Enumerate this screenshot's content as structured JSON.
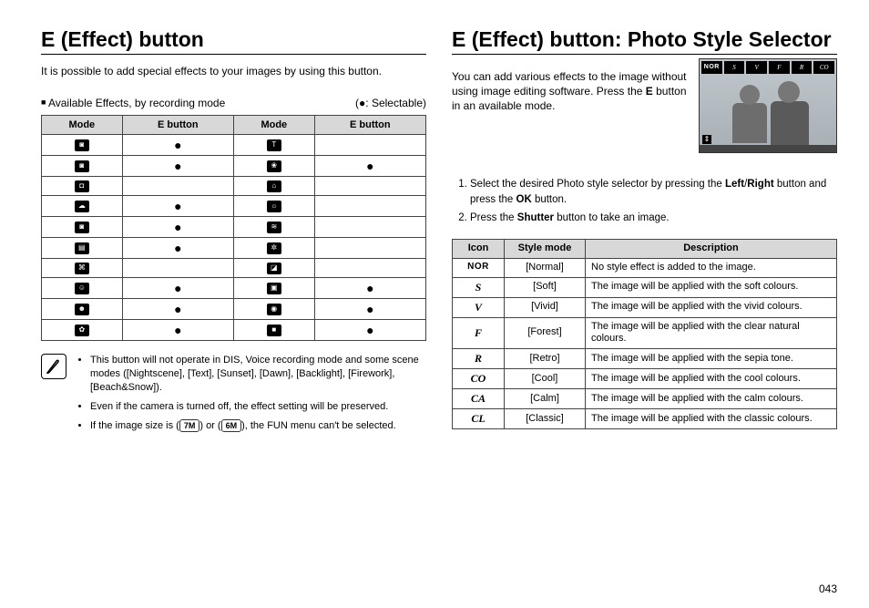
{
  "page_number": "043",
  "left": {
    "heading": "E (Effect) button",
    "intro": "It is possible to add special effects to your images by using this button.",
    "subhead": "Available Effects, by recording mode",
    "legend": "(●: Selectable)",
    "table": {
      "headers": [
        "Mode",
        "E button",
        "Mode",
        "E button"
      ],
      "rows": [
        {
          "m1": "◙",
          "e1": "●",
          "m2": "T",
          "e2": ""
        },
        {
          "m1": "◙",
          "e1": "●",
          "m2": "❀",
          "e2": "●"
        },
        {
          "m1": "◘",
          "e1": "",
          "m2": "⌂",
          "e2": ""
        },
        {
          "m1": "☁",
          "e1": "●",
          "m2": "☼",
          "e2": ""
        },
        {
          "m1": "◙",
          "e1": "●",
          "m2": "≋",
          "e2": ""
        },
        {
          "m1": "▤",
          "e1": "●",
          "m2": "✲",
          "e2": ""
        },
        {
          "m1": "⌘",
          "e1": "",
          "m2": "◪",
          "e2": ""
        },
        {
          "m1": "☺",
          "e1": "●",
          "m2": "▣",
          "e2": "●"
        },
        {
          "m1": "☻",
          "e1": "●",
          "m2": "◉",
          "e2": "●"
        },
        {
          "m1": "✿",
          "e1": "●",
          "m2": "■",
          "e2": "●"
        }
      ]
    },
    "notes": [
      "This button will not operate in DIS, Voice recording mode and some scene modes ([Nightscene], [Text], [Sunset], [Dawn], [Backlight], [Firework], [Beach&Snow]).",
      "Even if the camera is turned off, the effect setting will be preserved."
    ],
    "note3_pre": "If the image size is (",
    "note3_size1": "7M",
    "note3_mid": ") or (",
    "note3_size2": "6M",
    "note3_post": "), the FUN menu can't be selected."
  },
  "right": {
    "heading": "E (Effect) button: Photo Style Selector",
    "intro_pre": "You can add various effects to the image without using image editing software. Press the ",
    "intro_bold": "E",
    "intro_post": " button in an available mode.",
    "preview_tabs": [
      "NOR",
      "S",
      "V",
      "F",
      "R",
      "CO"
    ],
    "step1_pre": "Select the desired Photo style selector by pressing the ",
    "step1_b1": "Left",
    "step1_sep": "/",
    "step1_b2": "Right",
    "step1_mid": " button and press the ",
    "step1_b3": "OK",
    "step1_post": " button.",
    "step2_pre": "Press the ",
    "step2_b1": "Shutter",
    "step2_post": " button to take an image.",
    "table": {
      "headers": [
        "Icon",
        "Style mode",
        "Description"
      ],
      "rows": [
        {
          "icon": "NOR",
          "icon_nor": true,
          "mode": "[Normal]",
          "desc": "No style effect is added to the image."
        },
        {
          "icon": "S",
          "mode": "[Soft]",
          "desc": "The image will be applied with the soft colours."
        },
        {
          "icon": "V",
          "mode": "[Vivid]",
          "desc": "The image will be applied with the vivid colours."
        },
        {
          "icon": "F",
          "mode": "[Forest]",
          "desc": "The image will be applied with the clear natural colours."
        },
        {
          "icon": "R",
          "mode": "[Retro]",
          "desc": "The image will be applied with the sepia tone."
        },
        {
          "icon": "CO",
          "mode": "[Cool]",
          "desc": "The image will be applied with the cool colours."
        },
        {
          "icon": "CA",
          "mode": "[Calm]",
          "desc": "The image will be applied with the calm colours."
        },
        {
          "icon": "CL",
          "mode": "[Classic]",
          "desc": "The image will be applied with the classic colours."
        }
      ]
    }
  }
}
